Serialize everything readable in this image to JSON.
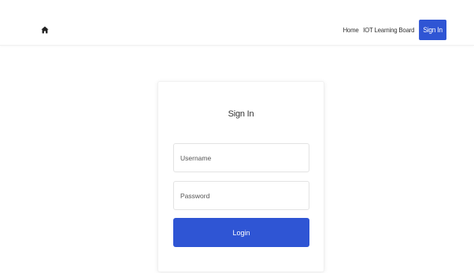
{
  "header": {
    "home_icon": "home-icon",
    "nav": {
      "home_label": "Home",
      "iot_label": "IOT Learning Board",
      "signin_label": "Sign In"
    }
  },
  "signin_form": {
    "title": "Sign In",
    "username": {
      "placeholder": "Username",
      "value": ""
    },
    "password": {
      "placeholder": "Password",
      "value": ""
    },
    "login_label": "Login"
  },
  "colors": {
    "accent": "#2f55d4",
    "background": "#ffffff"
  }
}
